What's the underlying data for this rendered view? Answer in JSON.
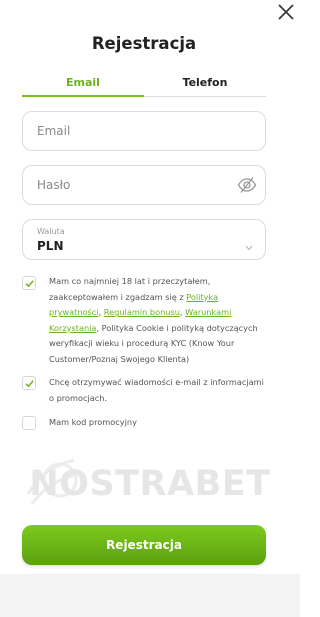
{
  "modal": {
    "title": "Rejestracja"
  },
  "tabs": [
    {
      "label": "Email",
      "active": true
    },
    {
      "label": "Telefon",
      "active": false
    }
  ],
  "fields": {
    "email_placeholder": "Email",
    "password_placeholder": "Hasło",
    "currency_label": "Waluta",
    "currency_value": "PLN"
  },
  "consents": {
    "terms": {
      "checked": true,
      "text_1": "Mam co najmniej 18 lat i przeczytałem, zaakceptowałem i zgadzam się z ",
      "link_privacy": "Polityka prywatności",
      "sep_1": ", ",
      "link_bonus": "Regulamin bonusu",
      "sep_2": ", ",
      "link_conditions": "Warunkami Korzystania",
      "text_2": ", Polityka Cookie i polityką dotyczących weryfikacji wieku i procedurą KYC (Know Your Customer/Poznaj Swojego Klienta)"
    },
    "marketing": {
      "checked": true,
      "text": "Chcę otrzymywać wiadomości e-mail z informacjami o promocjach."
    },
    "promo": {
      "checked": false,
      "text": "Mam kod promocyjny"
    }
  },
  "watermark": "NOSTRABET",
  "submit_label": "Rejestracja",
  "colors": {
    "accent": "#7cc11f",
    "link": "#6cb31e",
    "button_top": "#7ccb1c",
    "button_bottom": "#5b9f10"
  },
  "icons": {
    "close": "close-icon",
    "eye": "eye-off-icon",
    "chevron": "chevron-down-icon",
    "check": "check-icon"
  }
}
